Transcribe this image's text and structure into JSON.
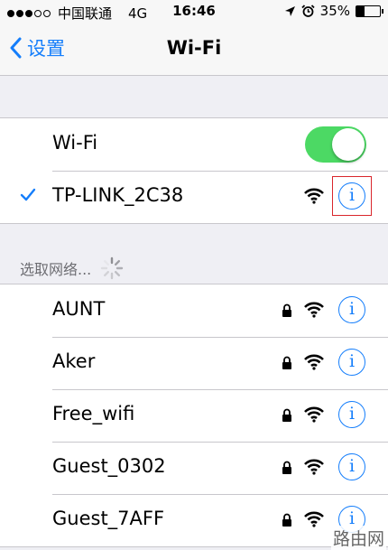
{
  "status_bar": {
    "carrier": "中国联通",
    "network": "4G",
    "time": "16:46",
    "battery": "35%",
    "battery_level": 0.35
  },
  "nav": {
    "back_label": "设置",
    "title": "Wi-Fi"
  },
  "wifi_toggle": {
    "label": "Wi-Fi",
    "on": true
  },
  "connected": {
    "name": "TP-LINK_2C38"
  },
  "section_header": "选取网络...",
  "networks": [
    {
      "name": "AUNT"
    },
    {
      "name": "Aker"
    },
    {
      "name": "Free_wifi"
    },
    {
      "name": "Guest_0302"
    },
    {
      "name": "Guest_7AFF"
    }
  ],
  "colors": {
    "accent": "#157efb",
    "toggle_on": "#4cd964",
    "highlight": "#d9262c"
  },
  "watermark": "路由网"
}
